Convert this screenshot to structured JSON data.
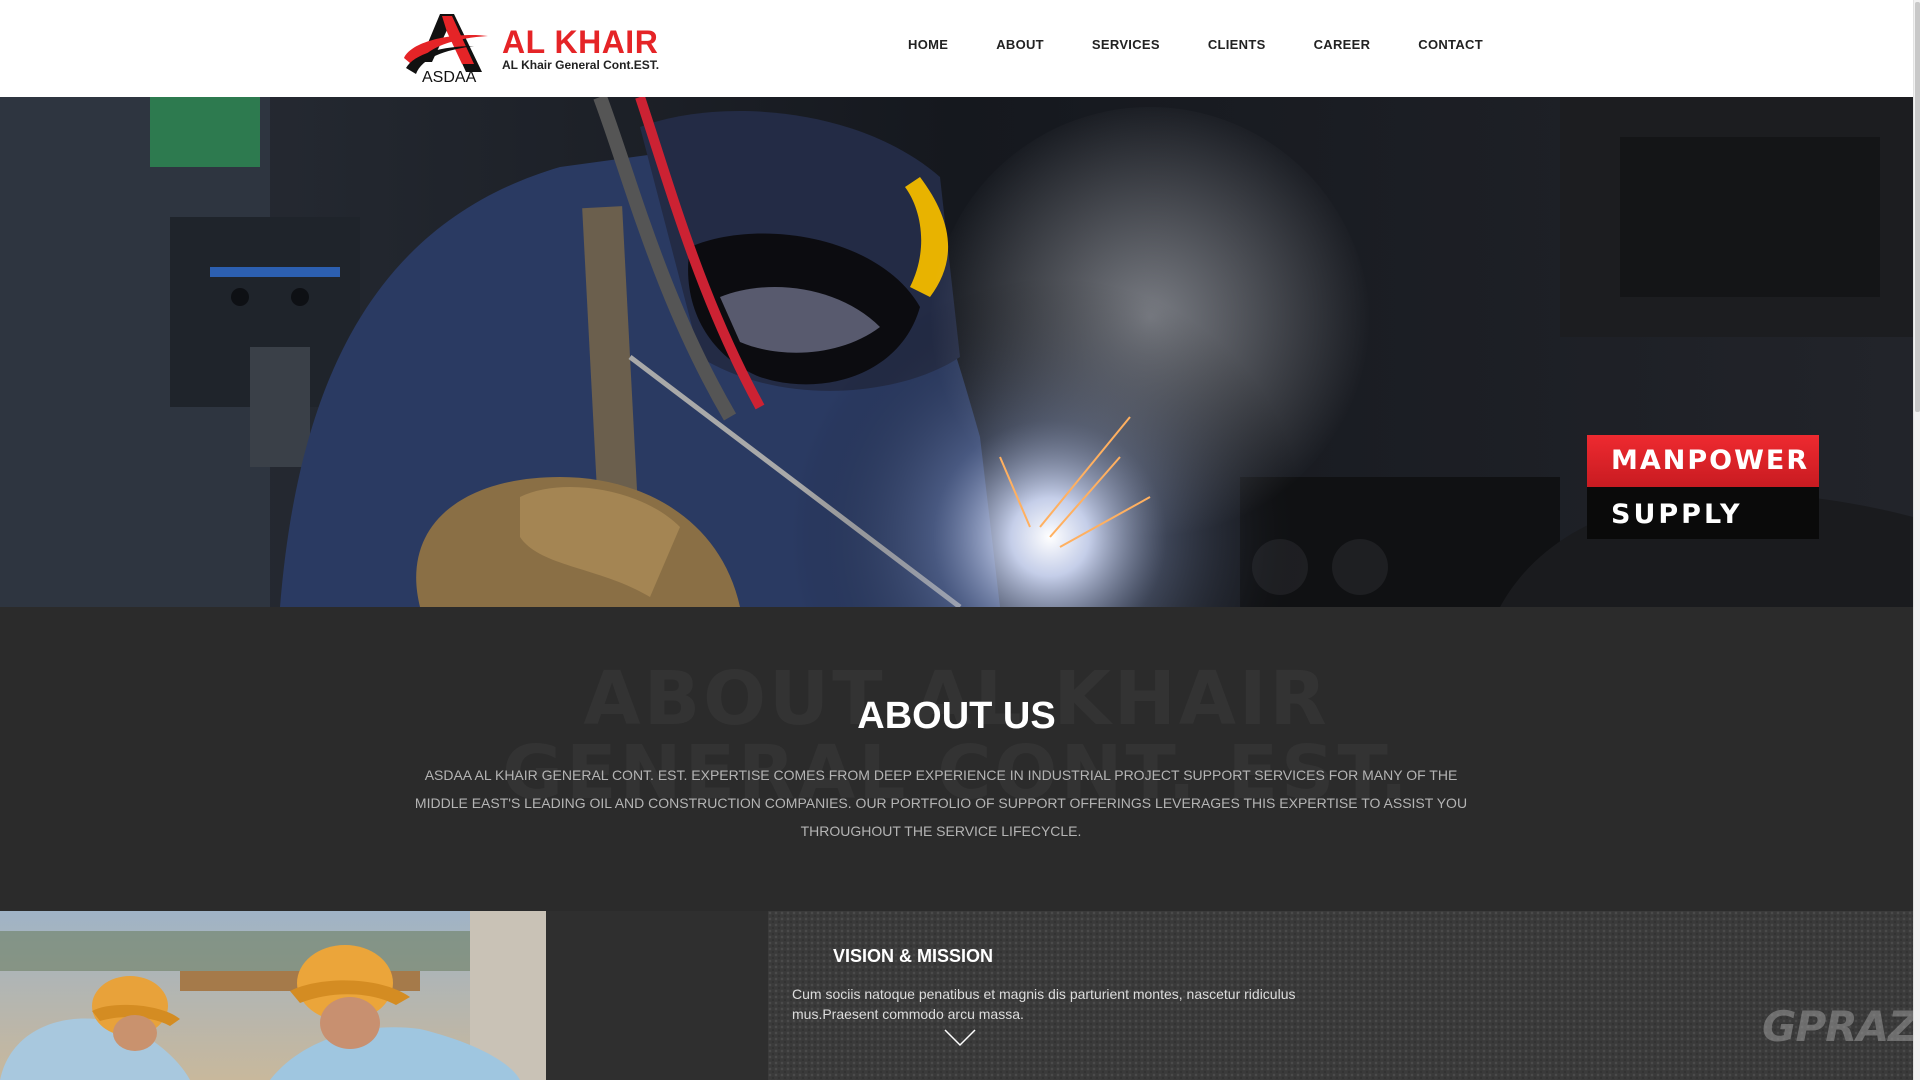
{
  "logo": {
    "mark_text": "ASDAA",
    "title": "AL KHAIR",
    "subtitle": "AL Khair General Cont.EST."
  },
  "nav": {
    "items": [
      "HOME",
      "ABOUT",
      "SERVICES",
      "CLIENTS",
      "CAREER",
      "CONTACT"
    ]
  },
  "hero": {
    "badge_line1": "MANPOWER",
    "badge_line2": "SUPPLY"
  },
  "about": {
    "ghost_heading": "ABOUT AL KHAIR GENERAL CONT. EST.",
    "title": "ABOUT US",
    "text": "ASDAA AL KHAIR GENERAL CONT. EST. EXPERTISE COMES FROM DEEP EXPERIENCE IN INDUSTRIAL PROJECT SUPPORT SERVICES FOR MANY OF THE MIDDLE EAST'S LEADING OIL AND CONSTRUCTION COMPANIES. OUR PORTFOLIO OF SUPPORT OFFERINGS LEVERAGES THIS EXPERTISE TO ASSIST YOU THROUGHOUT THE SERVICE LIFECYCLE."
  },
  "vision": {
    "title": "VISION & MISSION",
    "text": "Cum sociis natoque penatibus et magnis dis parturient montes, nascetur ridiculus mus.Praesent commodo arcu massa."
  },
  "watermark": "GPRAZAD",
  "colors": {
    "brand_red": "#e52427",
    "dark_section": "#2b2b2b",
    "vision_bg": "#3a3a3a"
  },
  "icons": {
    "logo": "logo-a-swoosh-icon",
    "expand": "chevron-down-icon"
  }
}
